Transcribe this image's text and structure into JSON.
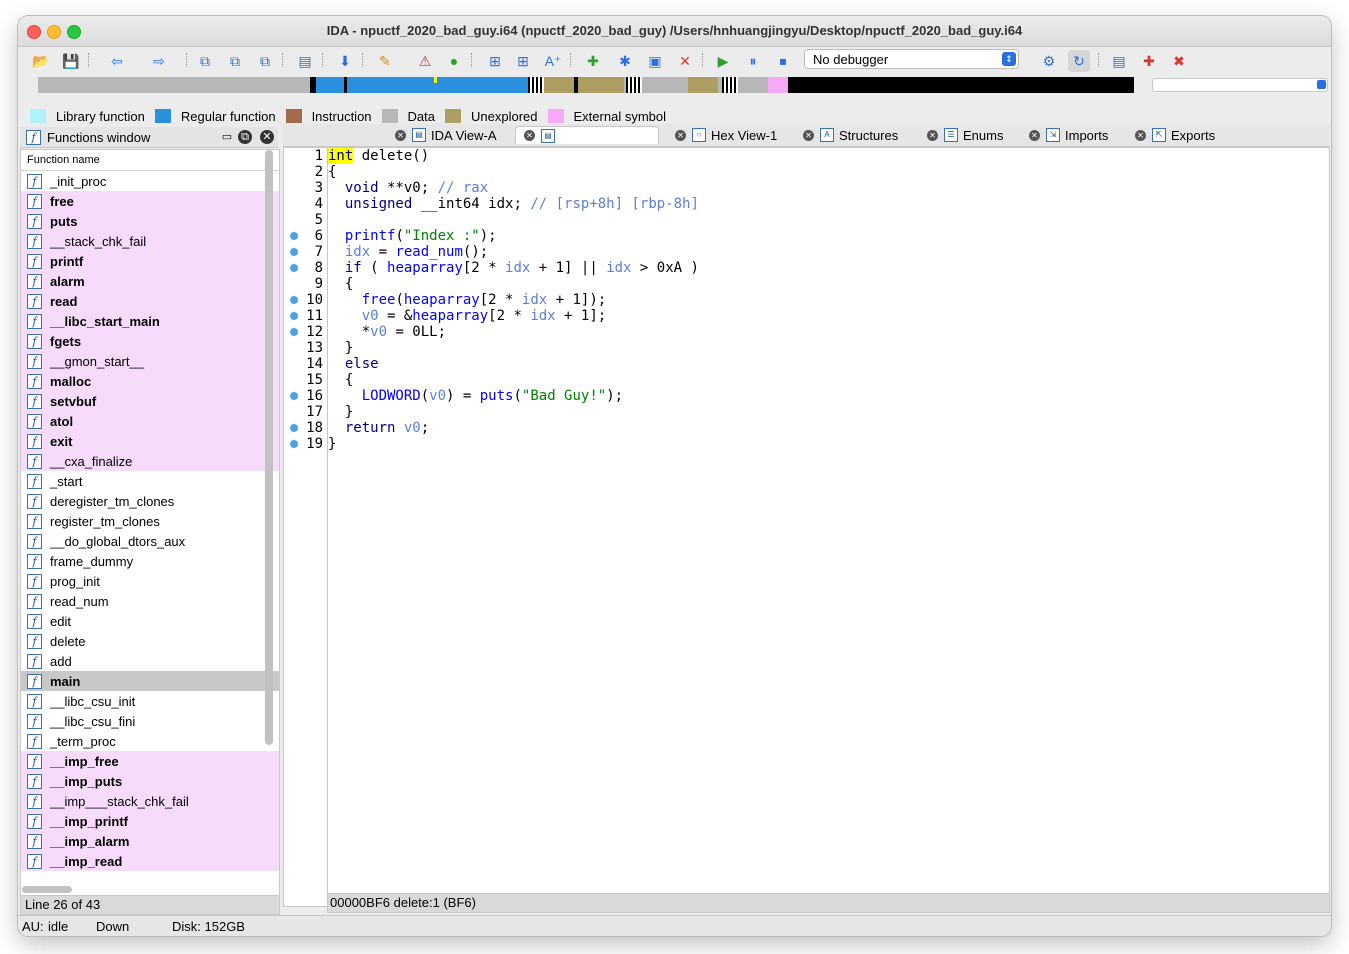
{
  "window": {
    "title": "IDA - npuctf_2020_bad_guy.i64 (npuctf_2020_bad_guy) /Users/hnhuangjingyu/Desktop/npuctf_2020_bad_guy.i64"
  },
  "toolbar": {
    "debugger_select": "No debugger"
  },
  "legend": [
    {
      "label": "Library function",
      "color": "#aef4f8"
    },
    {
      "label": "Regular function",
      "color": "#2a8fdd"
    },
    {
      "label": "Instruction",
      "color": "#a46a4e"
    },
    {
      "label": "Data",
      "color": "#b7b7b7"
    },
    {
      "label": "Unexplored",
      "color": "#ad9e63"
    },
    {
      "label": "External symbol",
      "color": "#f6a9f6"
    }
  ],
  "functions_window": {
    "title": "Functions window",
    "column": "Function name",
    "items": [
      {
        "name": "_init_proc",
        "ext": false,
        "bold": false
      },
      {
        "name": "free",
        "ext": true,
        "bold": true
      },
      {
        "name": "puts",
        "ext": true,
        "bold": true
      },
      {
        "name": "__stack_chk_fail",
        "ext": true,
        "bold": false
      },
      {
        "name": "printf",
        "ext": true,
        "bold": true
      },
      {
        "name": "alarm",
        "ext": true,
        "bold": true
      },
      {
        "name": "read",
        "ext": true,
        "bold": true
      },
      {
        "name": "__libc_start_main",
        "ext": true,
        "bold": true
      },
      {
        "name": "fgets",
        "ext": true,
        "bold": true
      },
      {
        "name": "__gmon_start__",
        "ext": true,
        "bold": false
      },
      {
        "name": "malloc",
        "ext": true,
        "bold": true
      },
      {
        "name": "setvbuf",
        "ext": true,
        "bold": true
      },
      {
        "name": "atol",
        "ext": true,
        "bold": true
      },
      {
        "name": "exit",
        "ext": true,
        "bold": true
      },
      {
        "name": "__cxa_finalize",
        "ext": true,
        "bold": false
      },
      {
        "name": "_start",
        "ext": false,
        "bold": false
      },
      {
        "name": "deregister_tm_clones",
        "ext": false,
        "bold": false
      },
      {
        "name": "register_tm_clones",
        "ext": false,
        "bold": false
      },
      {
        "name": "__do_global_dtors_aux",
        "ext": false,
        "bold": false
      },
      {
        "name": "frame_dummy",
        "ext": false,
        "bold": false
      },
      {
        "name": "prog_init",
        "ext": false,
        "bold": false
      },
      {
        "name": "read_num",
        "ext": false,
        "bold": false
      },
      {
        "name": "edit",
        "ext": false,
        "bold": false
      },
      {
        "name": "delete",
        "ext": false,
        "bold": false
      },
      {
        "name": "add",
        "ext": false,
        "bold": false
      },
      {
        "name": "main",
        "ext": false,
        "bold": true,
        "selected": true
      },
      {
        "name": "__libc_csu_init",
        "ext": false,
        "bold": false
      },
      {
        "name": "__libc_csu_fini",
        "ext": false,
        "bold": false
      },
      {
        "name": "_term_proc",
        "ext": false,
        "bold": false
      },
      {
        "name": "__imp_free",
        "ext": true,
        "bold": true
      },
      {
        "name": "__imp_puts",
        "ext": true,
        "bold": true
      },
      {
        "name": "__imp___stack_chk_fail",
        "ext": true,
        "bold": false
      },
      {
        "name": "__imp_printf",
        "ext": true,
        "bold": true
      },
      {
        "name": "__imp_alarm",
        "ext": true,
        "bold": true
      },
      {
        "name": "__imp_read",
        "ext": true,
        "bold": true
      }
    ],
    "status": "Line 26 of 43"
  },
  "tabs": [
    {
      "label": "IDA View-A",
      "icon": "ida-view-icon"
    },
    {
      "label": "",
      "icon": "pseudocode-icon",
      "active": true
    },
    {
      "label": "Hex View-1",
      "icon": "hex-icon"
    },
    {
      "label": "Structures",
      "icon": "structures-icon"
    },
    {
      "label": "Enums",
      "icon": "enums-icon"
    },
    {
      "label": "Imports",
      "icon": "imports-icon"
    },
    {
      "label": "Exports",
      "icon": "exports-icon"
    }
  ],
  "pseudocode": {
    "lines": [
      {
        "n": "1",
        "bp": false,
        "html": "<span class=\"kw hl\">int</span> delete()"
      },
      {
        "n": "2",
        "bp": false,
        "html": "{"
      },
      {
        "n": "3",
        "bp": false,
        "html": "  <span class=\"kw\">void</span> **v0; <span class=\"com\">// rax</span>"
      },
      {
        "n": "4",
        "bp": false,
        "html": "  <span class=\"kw\">unsigned</span> __int64 idx; <span class=\"com\">// [rsp+8h] [rbp-8h]</span>"
      },
      {
        "n": "5",
        "bp": false,
        "html": ""
      },
      {
        "n": "6",
        "bp": true,
        "html": "  <span class=\"fn\">printf</span>(<span class=\"str\">\"Index :\"</span>);"
      },
      {
        "n": "7",
        "bp": true,
        "html": "  <span class=\"var\">idx</span> = <span class=\"fn\">read_num</span>();"
      },
      {
        "n": "8",
        "bp": true,
        "html": "  <span class=\"kw\">if</span> ( <span class=\"fn\">heaparray</span>[2 * <span class=\"var\">idx</span> + 1] || <span class=\"var\">idx</span> &gt; 0xA )"
      },
      {
        "n": "9",
        "bp": false,
        "html": "  {"
      },
      {
        "n": "10",
        "bp": true,
        "html": "    <span class=\"fn\">free</span>(<span class=\"fn\">heaparray</span>[2 * <span class=\"var\">idx</span> + 1]);"
      },
      {
        "n": "11",
        "bp": true,
        "html": "    <span class=\"var\">v0</span> = &amp;<span class=\"fn\">heaparray</span>[2 * <span class=\"var\">idx</span> + 1];"
      },
      {
        "n": "12",
        "bp": true,
        "html": "    *<span class=\"var\">v0</span> = 0LL;"
      },
      {
        "n": "13",
        "bp": false,
        "html": "  }"
      },
      {
        "n": "14",
        "bp": false,
        "html": "  <span class=\"kw\">else</span>"
      },
      {
        "n": "15",
        "bp": false,
        "html": "  {"
      },
      {
        "n": "16",
        "bp": true,
        "html": "    <span class=\"fn\">LODWORD</span>(<span class=\"var\">v0</span>) = <span class=\"fn\">puts</span>(<span class=\"str\">\"Bad Guy!\"</span>);"
      },
      {
        "n": "17",
        "bp": false,
        "html": "  }"
      },
      {
        "n": "18",
        "bp": true,
        "html": "  <span class=\"kw\">return</span> <span class=\"var\">v0</span>;"
      },
      {
        "n": "19",
        "bp": true,
        "html": "}"
      }
    ],
    "status": "00000BF6  delete:1 (BF6)"
  },
  "statusbar": {
    "au": "AU:",
    "au_state": "idle",
    "direction": "Down",
    "disk": "Disk: 152GB"
  }
}
